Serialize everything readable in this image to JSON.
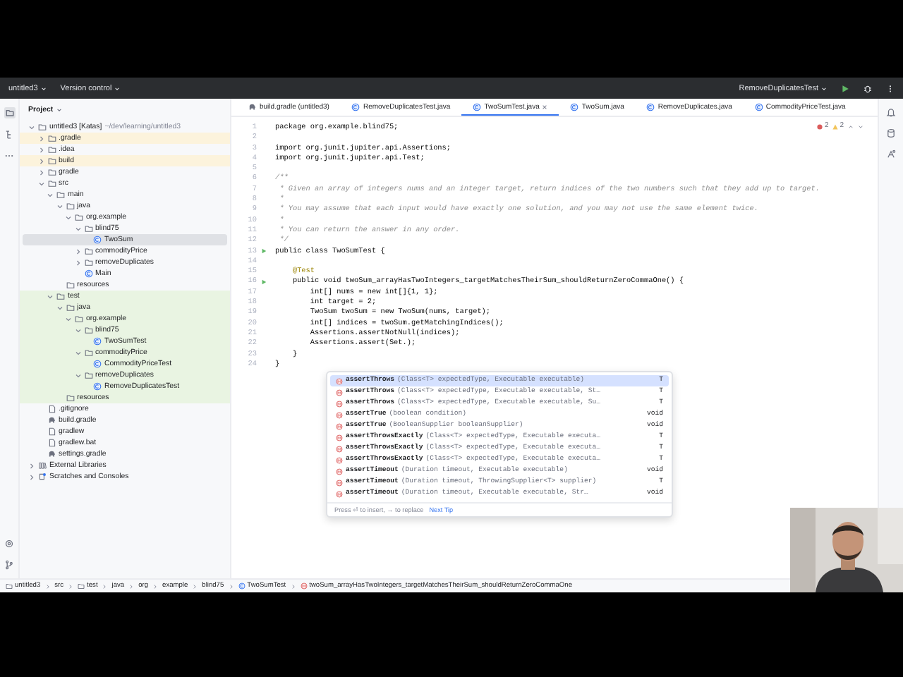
{
  "titlebar": {
    "project": "untitled3",
    "vcs": "Version control",
    "run_config": "RemoveDuplicatesTest"
  },
  "project": {
    "title": "Project",
    "tree": [
      {
        "label": "untitled3 [Katas]",
        "hint": "~/dev/learning/untitled3",
        "kind": "module",
        "selected": false,
        "expanded": true,
        "children": [
          {
            "label": ".gradle",
            "kind": "folder",
            "selected": false,
            "expanded": false,
            "excluded": true
          },
          {
            "label": ".idea",
            "kind": "folder",
            "selected": false,
            "expanded": false
          },
          {
            "label": "build",
            "kind": "folder",
            "selected": false,
            "expanded": false,
            "excluded": true
          },
          {
            "label": "gradle",
            "kind": "folder",
            "selected": false,
            "expanded": false
          },
          {
            "label": "src",
            "kind": "folder",
            "selected": false,
            "expanded": true,
            "children": [
              {
                "label": "main",
                "kind": "folder",
                "selected": false,
                "expanded": true,
                "children": [
                  {
                    "label": "java",
                    "kind": "folder",
                    "selected": false,
                    "expanded": true,
                    "children": [
                      {
                        "label": "org.example",
                        "kind": "package",
                        "selected": false,
                        "expanded": true,
                        "children": [
                          {
                            "label": "blind75",
                            "kind": "package",
                            "selected": false,
                            "expanded": true,
                            "children": [
                              {
                                "label": "TwoSum",
                                "kind": "class",
                                "selected": true
                              }
                            ]
                          },
                          {
                            "label": "commodityPrice",
                            "kind": "package",
                            "selected": false,
                            "expanded": false
                          },
                          {
                            "label": "removeDuplicates",
                            "kind": "package",
                            "selected": false,
                            "expanded": false
                          },
                          {
                            "label": "Main",
                            "kind": "class",
                            "selected": false
                          }
                        ]
                      }
                    ]
                  },
                  {
                    "label": "resources",
                    "kind": "folder",
                    "selected": false
                  }
                ]
              },
              {
                "label": "test",
                "kind": "folder",
                "selected": false,
                "expanded": true,
                "test_sources": true,
                "children": [
                  {
                    "label": "java",
                    "kind": "folder",
                    "selected": false,
                    "expanded": true,
                    "children": [
                      {
                        "label": "org.example",
                        "kind": "package",
                        "selected": false,
                        "expanded": true,
                        "children": [
                          {
                            "label": "blind75",
                            "kind": "package",
                            "selected": false,
                            "expanded": true,
                            "children": [
                              {
                                "label": "TwoSumTest",
                                "kind": "class",
                                "selected": false
                              }
                            ]
                          },
                          {
                            "label": "commodityPrice",
                            "kind": "package",
                            "selected": false,
                            "expanded": true,
                            "children": [
                              {
                                "label": "CommodityPriceTest",
                                "kind": "class",
                                "selected": false
                              }
                            ]
                          },
                          {
                            "label": "removeDuplicates",
                            "kind": "package",
                            "selected": false,
                            "expanded": true,
                            "children": [
                              {
                                "label": "RemoveDuplicatesTest",
                                "kind": "class",
                                "selected": false
                              }
                            ]
                          }
                        ]
                      }
                    ]
                  },
                  {
                    "label": "resources",
                    "kind": "folder",
                    "selected": false
                  }
                ]
              }
            ]
          },
          {
            "label": ".gitignore",
            "kind": "file",
            "selected": false
          },
          {
            "label": "build.gradle",
            "kind": "gradle",
            "selected": false
          },
          {
            "label": "gradlew",
            "kind": "file",
            "selected": false
          },
          {
            "label": "gradlew.bat",
            "kind": "file",
            "selected": false
          },
          {
            "label": "settings.gradle",
            "kind": "gradle",
            "selected": false
          }
        ]
      },
      {
        "label": "External Libraries",
        "kind": "library",
        "selected": false,
        "expanded": false
      },
      {
        "label": "Scratches and Consoles",
        "kind": "scratch",
        "selected": false,
        "expanded": false
      }
    ]
  },
  "editor": {
    "tabs": [
      {
        "label": "build.gradle (untitled3)",
        "kind": "gradle",
        "selected": false
      },
      {
        "label": "RemoveDuplicatesTest.java",
        "kind": "class",
        "selected": false
      },
      {
        "label": "TwoSumTest.java",
        "kind": "class",
        "selected": true
      },
      {
        "label": "TwoSum.java",
        "kind": "class",
        "selected": false
      },
      {
        "label": "RemoveDuplicates.java",
        "kind": "class",
        "selected": false
      },
      {
        "label": "CommodityPriceTest.java",
        "kind": "class",
        "selected": false
      }
    ],
    "inspections": {
      "errors": "2",
      "warnings": "2"
    },
    "lines": [
      {
        "number": "1",
        "text": "package org.example.blind75;",
        "kind": "code",
        "run": false
      },
      {
        "number": "2",
        "run": false
      },
      {
        "number": "3",
        "text": "import org.junit.jupiter.api.Assertions;",
        "kind": "code",
        "run": false
      },
      {
        "number": "4",
        "text": "import org.junit.jupiter.api.Test;",
        "kind": "code",
        "run": false
      },
      {
        "number": "5",
        "run": false
      },
      {
        "number": "6",
        "text": "/**",
        "kind": "comment",
        "run": false
      },
      {
        "number": "7",
        "text": " * Given an array of integers nums and an integer target, return indices of the two numbers such that they add up to target.",
        "kind": "comment",
        "run": false
      },
      {
        "number": "8",
        "text": " *",
        "kind": "comment",
        "run": false
      },
      {
        "number": "9",
        "text": " * You may assume that each input would have exactly one solution, and you may not use the same element twice.",
        "kind": "comment",
        "run": false
      },
      {
        "number": "10",
        "text": " *",
        "kind": "comment",
        "run": false
      },
      {
        "number": "11",
        "text": " * You can return the answer in any order.",
        "kind": "comment",
        "run": false
      },
      {
        "number": "12",
        "text": " */",
        "kind": "comment",
        "run": false
      },
      {
        "number": "13",
        "text": "public class TwoSumTest {",
        "kind": "code",
        "run": true
      },
      {
        "number": "14",
        "run": false
      },
      {
        "number": "15",
        "text": "    @Test",
        "kind": "annotation",
        "run": false
      },
      {
        "number": "16",
        "text": "    public void twoSum_arrayHasTwoIntegers_targetMatchesTheirSum_shouldReturnZeroCommaOne() {",
        "kind": "code",
        "run": true
      },
      {
        "number": "17",
        "text": "        int[] nums = new int[]{1, 1};",
        "kind": "code",
        "run": false
      },
      {
        "number": "18",
        "text": "        int target = 2;",
        "kind": "code",
        "run": false
      },
      {
        "number": "19",
        "text": "        TwoSum twoSum = new TwoSum(nums, target);",
        "kind": "code",
        "run": false
      },
      {
        "number": "20",
        "text": "        int[] indices = twoSum.getMatchingIndices();",
        "kind": "code",
        "run": false
      },
      {
        "number": "21",
        "text": "        Assertions.assertNotNull(indices);",
        "kind": "code",
        "run": false
      },
      {
        "number": "22",
        "text": "        Assertions.assert(Set.);",
        "kind": "code",
        "run": false
      },
      {
        "number": "23",
        "text": "    }",
        "kind": "code",
        "run": false
      },
      {
        "number": "24",
        "text": "}",
        "kind": "code",
        "run": false
      }
    ],
    "completion": {
      "items": [
        {
          "name": "assertThrows",
          "params": "(Class<T> expectedType, Executable executable)",
          "type": "T",
          "selected": true
        },
        {
          "name": "assertThrows",
          "params": "(Class<T> expectedType, Executable executable, St…",
          "type": "T",
          "selected": false
        },
        {
          "name": "assertThrows",
          "params": "(Class<T> expectedType, Executable executable, Su…",
          "type": "T",
          "selected": false
        },
        {
          "name": "assertTrue",
          "params": "(boolean condition)",
          "type": "void",
          "selected": false
        },
        {
          "name": "assertTrue",
          "params": "(BooleanSupplier booleanSupplier)",
          "type": "void",
          "selected": false
        },
        {
          "name": "assertThrowsExactly",
          "params": "(Class<T> expectedType, Executable executa…",
          "type": "T",
          "selected": false
        },
        {
          "name": "assertThrowsExactly",
          "params": "(Class<T> expectedType, Executable executa…",
          "type": "T",
          "selected": false
        },
        {
          "name": "assertThrowsExactly",
          "params": "(Class<T> expectedType, Executable executa…",
          "type": "T",
          "selected": false
        },
        {
          "name": "assertTimeout",
          "params": "(Duration timeout, Executable executable)",
          "type": "void",
          "selected": false
        },
        {
          "name": "assertTimeout",
          "params": "(Duration timeout, ThrowingSupplier<T> supplier)",
          "type": "T",
          "selected": false
        },
        {
          "name": "assertTimeout",
          "params": "(Duration timeout, Executable executable, Str…",
          "type": "void",
          "selected": false
        }
      ],
      "hint": "Press ⏎ to insert, → to replace",
      "link": "Next Tip"
    }
  },
  "breadcrumb": [
    {
      "label": "untitled3",
      "kind": "module"
    },
    {
      "label": "src",
      "kind": "plain"
    },
    {
      "label": "test",
      "kind": "folder"
    },
    {
      "label": "java",
      "kind": "plain"
    },
    {
      "label": "org",
      "kind": "plain"
    },
    {
      "label": "example",
      "kind": "plain"
    },
    {
      "label": "blind75",
      "kind": "plain"
    },
    {
      "label": "TwoSumTest",
      "kind": "class"
    },
    {
      "label": "twoSum_arrayHasTwoIntegers_targetMatchesTheirSum_shouldReturnZeroCommaOne",
      "kind": "method"
    }
  ]
}
